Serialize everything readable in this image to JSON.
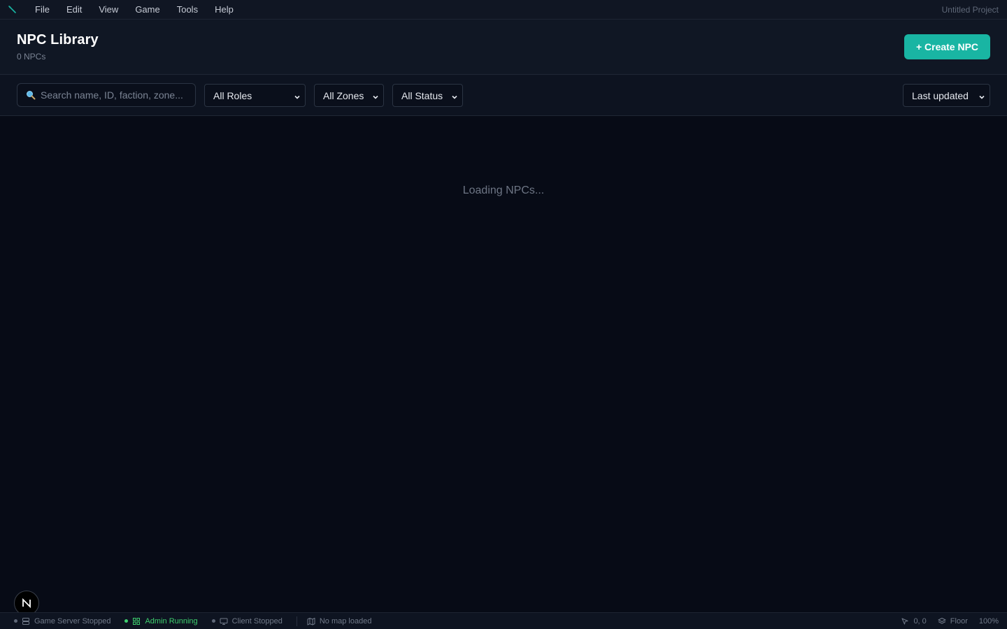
{
  "menubar": {
    "items": [
      "File",
      "Edit",
      "View",
      "Game",
      "Tools",
      "Help"
    ],
    "project": "Untitled Project"
  },
  "header": {
    "title": "NPC Library",
    "count": "0 NPCs",
    "create_label": "+ Create NPC"
  },
  "filters": {
    "search_placeholder": "Search name, ID, faction, zone...",
    "search_value": "",
    "roles": "All Roles",
    "zones": "All Zones",
    "status": "All Status",
    "sort": "Last updated"
  },
  "main": {
    "loading": "Loading NPCs..."
  },
  "avatar": {
    "letter": "N"
  },
  "statusbar": {
    "game_server": "Game Server Stopped",
    "admin": "Admin Running",
    "client": "Client Stopped",
    "map": "No map loaded",
    "coords": "0, 0",
    "layer": "Floor",
    "zoom": "100%"
  },
  "colors": {
    "accent": "#19b5a3",
    "running": "#3ecf6e",
    "stopped": "#5f6878",
    "background": "#070b16"
  },
  "icons": {
    "logo": "pen-icon",
    "search": "magnifier-icon",
    "server": "server-icon",
    "admin": "grid-icon",
    "client": "monitor-icon",
    "map": "map-icon",
    "cursor": "cursor-icon",
    "layers": "layers-icon"
  }
}
